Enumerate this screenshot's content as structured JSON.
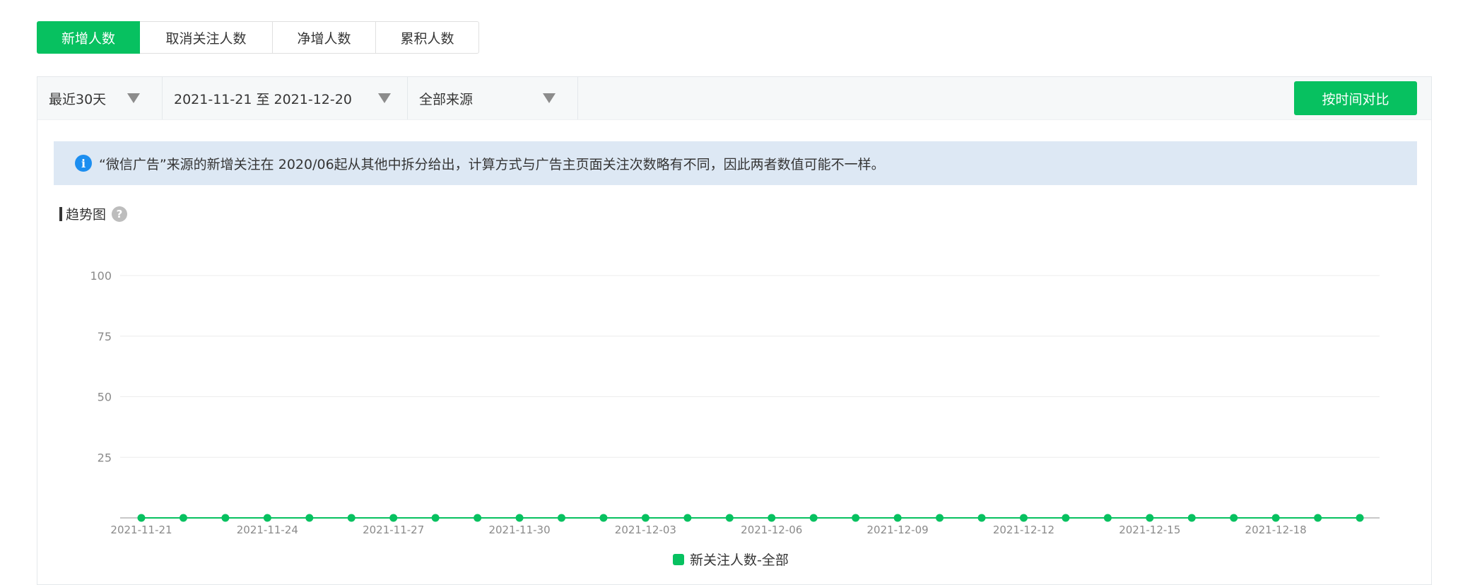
{
  "tabs": [
    {
      "label": "新增人数",
      "active": true
    },
    {
      "label": "取消关注人数",
      "active": false
    },
    {
      "label": "净增人数",
      "active": false
    },
    {
      "label": "累积人数",
      "active": false
    }
  ],
  "filters": {
    "range": "最近30天",
    "date_range": "2021-11-21 至 2021-12-20",
    "source": "全部来源",
    "compare_button": "按时间对比"
  },
  "notice": {
    "icon": "info-icon",
    "text": "“微信广告”来源的新增关注在 2020/06起从其他中拆分给出，计算方式与广告主页面关注次数略有不同，因此两者数值可能不一样。"
  },
  "section": {
    "title": "趋势图",
    "help": "?"
  },
  "colors": {
    "accent": "#07c160",
    "info": "#1c8ef0",
    "notice_bg": "#dde8f4"
  },
  "chart_data": {
    "type": "line",
    "x": [
      "2021-11-21",
      "2021-11-22",
      "2021-11-23",
      "2021-11-24",
      "2021-11-25",
      "2021-11-26",
      "2021-11-27",
      "2021-11-28",
      "2021-11-29",
      "2021-11-30",
      "2021-12-01",
      "2021-12-02",
      "2021-12-03",
      "2021-12-04",
      "2021-12-05",
      "2021-12-06",
      "2021-12-07",
      "2021-12-08",
      "2021-12-09",
      "2021-12-10",
      "2021-12-11",
      "2021-12-12",
      "2021-12-13",
      "2021-12-14",
      "2021-12-15",
      "2021-12-16",
      "2021-12-17",
      "2021-12-18",
      "2021-12-19",
      "2021-12-20"
    ],
    "x_tick_labels": [
      "2021-11-21",
      "2021-11-24",
      "2021-11-27",
      "2021-11-30",
      "2021-12-03",
      "2021-12-06",
      "2021-12-09",
      "2021-12-12",
      "2021-12-15",
      "2021-12-18"
    ],
    "y_ticks": [
      25,
      50,
      75,
      100
    ],
    "ylim": [
      0,
      100
    ],
    "grid": true,
    "series": [
      {
        "name": "新关注人数-全部",
        "color": "#07c160",
        "values": [
          0,
          0,
          0,
          0,
          0,
          0,
          0,
          0,
          0,
          0,
          0,
          0,
          0,
          0,
          0,
          0,
          0,
          0,
          0,
          0,
          0,
          0,
          0,
          0,
          0,
          0,
          0,
          0,
          0,
          0
        ]
      }
    ],
    "legend": "bottom-center"
  }
}
